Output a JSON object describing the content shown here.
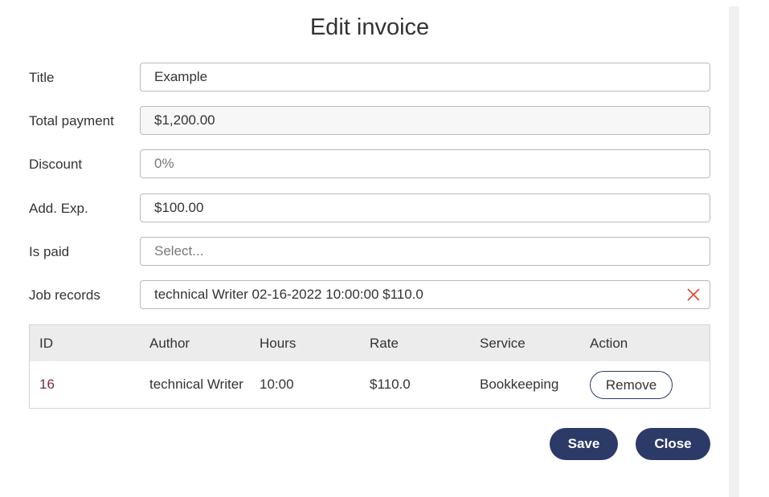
{
  "dialog": {
    "title": "Edit invoice"
  },
  "fields": [
    {
      "label": "Title",
      "value": "Example",
      "type": "text"
    },
    {
      "label": "Total payment",
      "value": "$1,200.00",
      "type": "readonly"
    },
    {
      "label": "Discount",
      "value": "0%",
      "type": "placeholder"
    },
    {
      "label": "Add. Exp.",
      "value": "$100.00",
      "type": "text"
    },
    {
      "label": "Is paid",
      "value": "Select...",
      "type": "placeholder"
    },
    {
      "label": "Job records",
      "value": "technical Writer 02-16-2022 10:00:00 $110.0",
      "type": "multiselect"
    }
  ],
  "table": {
    "headers": [
      "ID",
      "Author",
      "Hours",
      "Rate",
      "Service",
      "Action"
    ],
    "rows": [
      {
        "id": "16",
        "author": "technical Writer",
        "hours": "10:00",
        "rate": "$110.0",
        "service": "Bookkeeping",
        "action": "Remove"
      }
    ]
  },
  "buttons": {
    "save": "Save",
    "close": "Close"
  },
  "colors": {
    "primary": "#2b3a67",
    "clear": "#e74c3c",
    "id_text": "#7a2a3a"
  }
}
